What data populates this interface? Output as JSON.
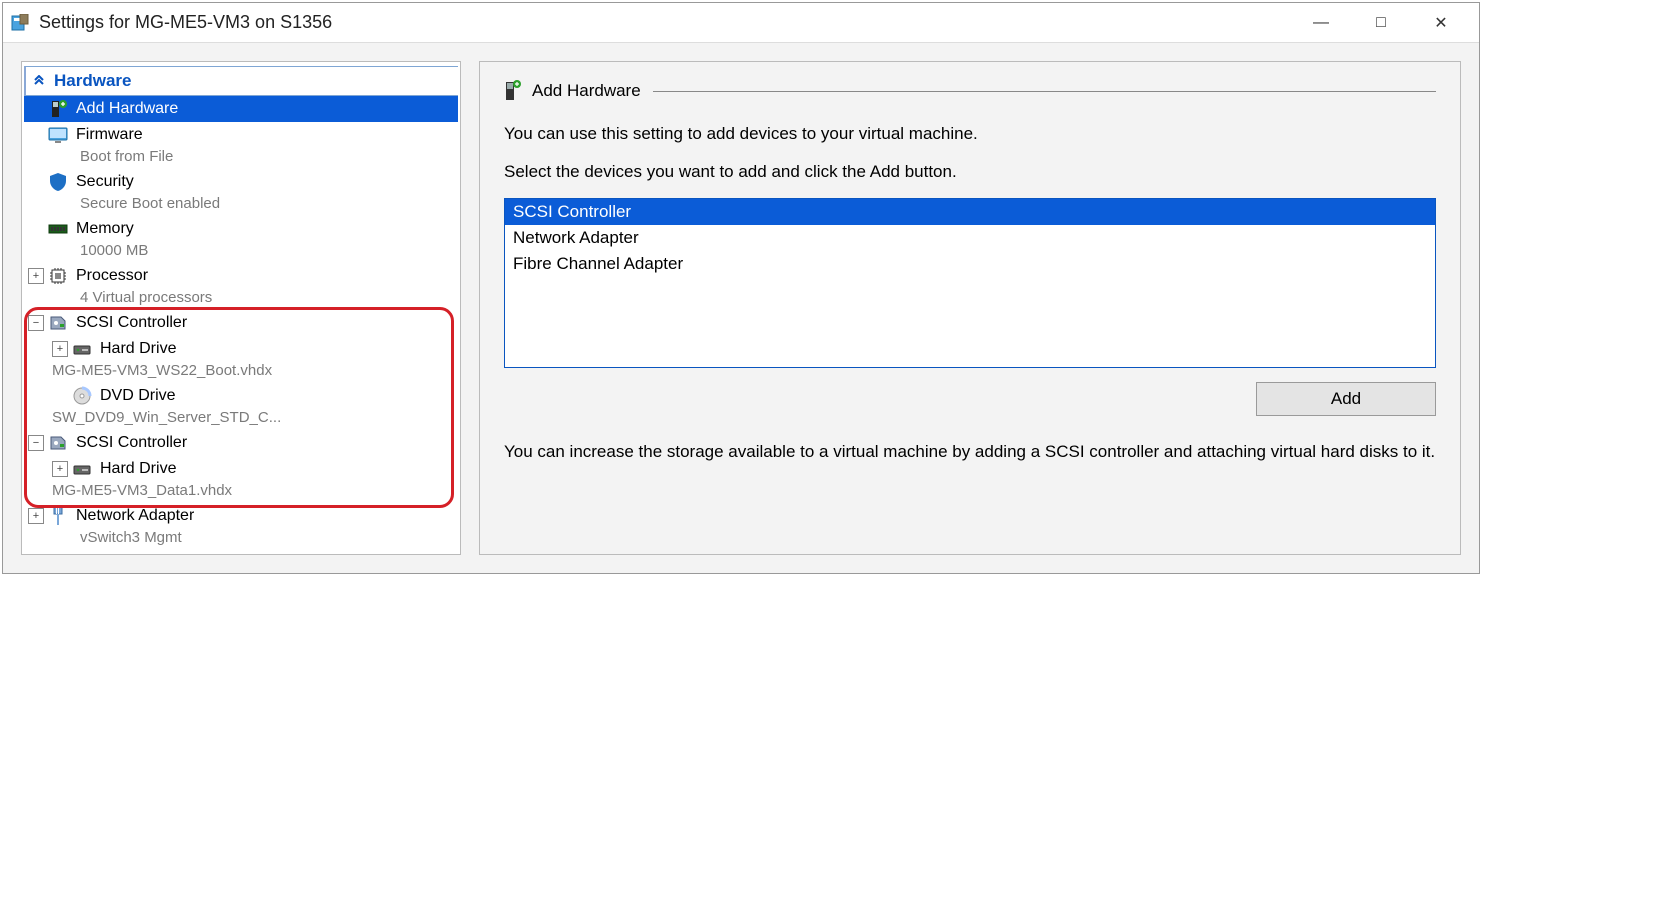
{
  "window": {
    "title": "Settings for MG-ME5-VM3 on S1356"
  },
  "sidebar": {
    "section": "Hardware",
    "items": [
      {
        "label": "Add Hardware",
        "sub": "",
        "icon": "add-hw",
        "selected": true,
        "expander": ""
      },
      {
        "label": "Firmware",
        "sub": "Boot from File",
        "icon": "monitor",
        "expander": ""
      },
      {
        "label": "Security",
        "sub": "Secure Boot enabled",
        "icon": "shield",
        "expander": ""
      },
      {
        "label": "Memory",
        "sub": "10000 MB",
        "icon": "ram",
        "expander": ""
      },
      {
        "label": "Processor",
        "sub": "4 Virtual processors",
        "icon": "cpu",
        "expander": "plus"
      },
      {
        "label": "SCSI Controller",
        "sub": "",
        "icon": "scsi",
        "expander": "minus",
        "children": [
          {
            "label": "Hard Drive",
            "sub": "MG-ME5-VM3_WS22_Boot.vhdx",
            "icon": "hdd",
            "expander": "plus"
          },
          {
            "label": "DVD Drive",
            "sub": "SW_DVD9_Win_Server_STD_C...",
            "icon": "dvd",
            "expander": ""
          }
        ]
      },
      {
        "label": "SCSI Controller",
        "sub": "",
        "icon": "scsi",
        "expander": "minus",
        "children": [
          {
            "label": "Hard Drive",
            "sub": "MG-ME5-VM3_Data1.vhdx",
            "icon": "hdd",
            "expander": "plus"
          }
        ]
      },
      {
        "label": "Network Adapter",
        "sub": "vSwitch3 Mgmt",
        "icon": "nic",
        "expander": "plus"
      }
    ]
  },
  "main": {
    "heading": "Add Hardware",
    "intro": "You can use this setting to add devices to your virtual machine.",
    "instruction": "Select the devices you want to add and click the Add button.",
    "devices": [
      "SCSI Controller",
      "Network Adapter",
      "Fibre Channel Adapter"
    ],
    "selectedDevice": "SCSI Controller",
    "addLabel": "Add",
    "note": "You can increase the storage available to a virtual machine by adding a SCSI controller and attaching virtual hard disks to it."
  }
}
